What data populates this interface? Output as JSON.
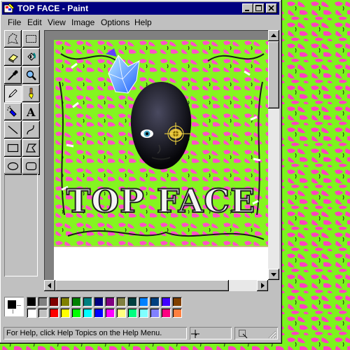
{
  "window": {
    "title_doc": "TOP FACE",
    "title_sep": " - ",
    "title_app": "Paint"
  },
  "menu": [
    {
      "label": "File"
    },
    {
      "label": "Edit"
    },
    {
      "label": "View"
    },
    {
      "label": "Image"
    },
    {
      "label": "Options"
    },
    {
      "label": "Help"
    }
  ],
  "tools": [
    {
      "name": "free-form-select-icon"
    },
    {
      "name": "rectangle-select-icon"
    },
    {
      "name": "eraser-icon"
    },
    {
      "name": "fill-bucket-icon"
    },
    {
      "name": "pick-color-icon"
    },
    {
      "name": "magnifier-icon"
    },
    {
      "name": "pencil-icon",
      "active": true
    },
    {
      "name": "brush-icon"
    },
    {
      "name": "airbrush-icon"
    },
    {
      "name": "text-icon"
    },
    {
      "name": "line-icon"
    },
    {
      "name": "curve-icon"
    },
    {
      "name": "rectangle-icon"
    },
    {
      "name": "polygon-icon"
    },
    {
      "name": "ellipse-icon"
    },
    {
      "name": "rounded-rectangle-icon"
    }
  ],
  "canvas": {
    "artwork_text": "TOP FACE",
    "background_colors": [
      "#80ff20",
      "#ff4fc8",
      "#ffffff"
    ]
  },
  "palette": {
    "foreground": "#000000",
    "background": "#ffffff",
    "colors_top": [
      "#000000",
      "#808080",
      "#800000",
      "#808000",
      "#008000",
      "#008080",
      "#000080",
      "#800080",
      "#808040",
      "#004040",
      "#0080ff",
      "#004080",
      "#4000ff",
      "#804000"
    ],
    "colors_bottom": [
      "#ffffff",
      "#c0c0c0",
      "#ff0000",
      "#ffff00",
      "#00ff00",
      "#00ffff",
      "#0000ff",
      "#ff00ff",
      "#ffff80",
      "#00ff80",
      "#80ffff",
      "#8080ff",
      "#ff0080",
      "#ff8040"
    ]
  },
  "status": {
    "message": "For Help, click Help Topics on the Help Menu."
  }
}
